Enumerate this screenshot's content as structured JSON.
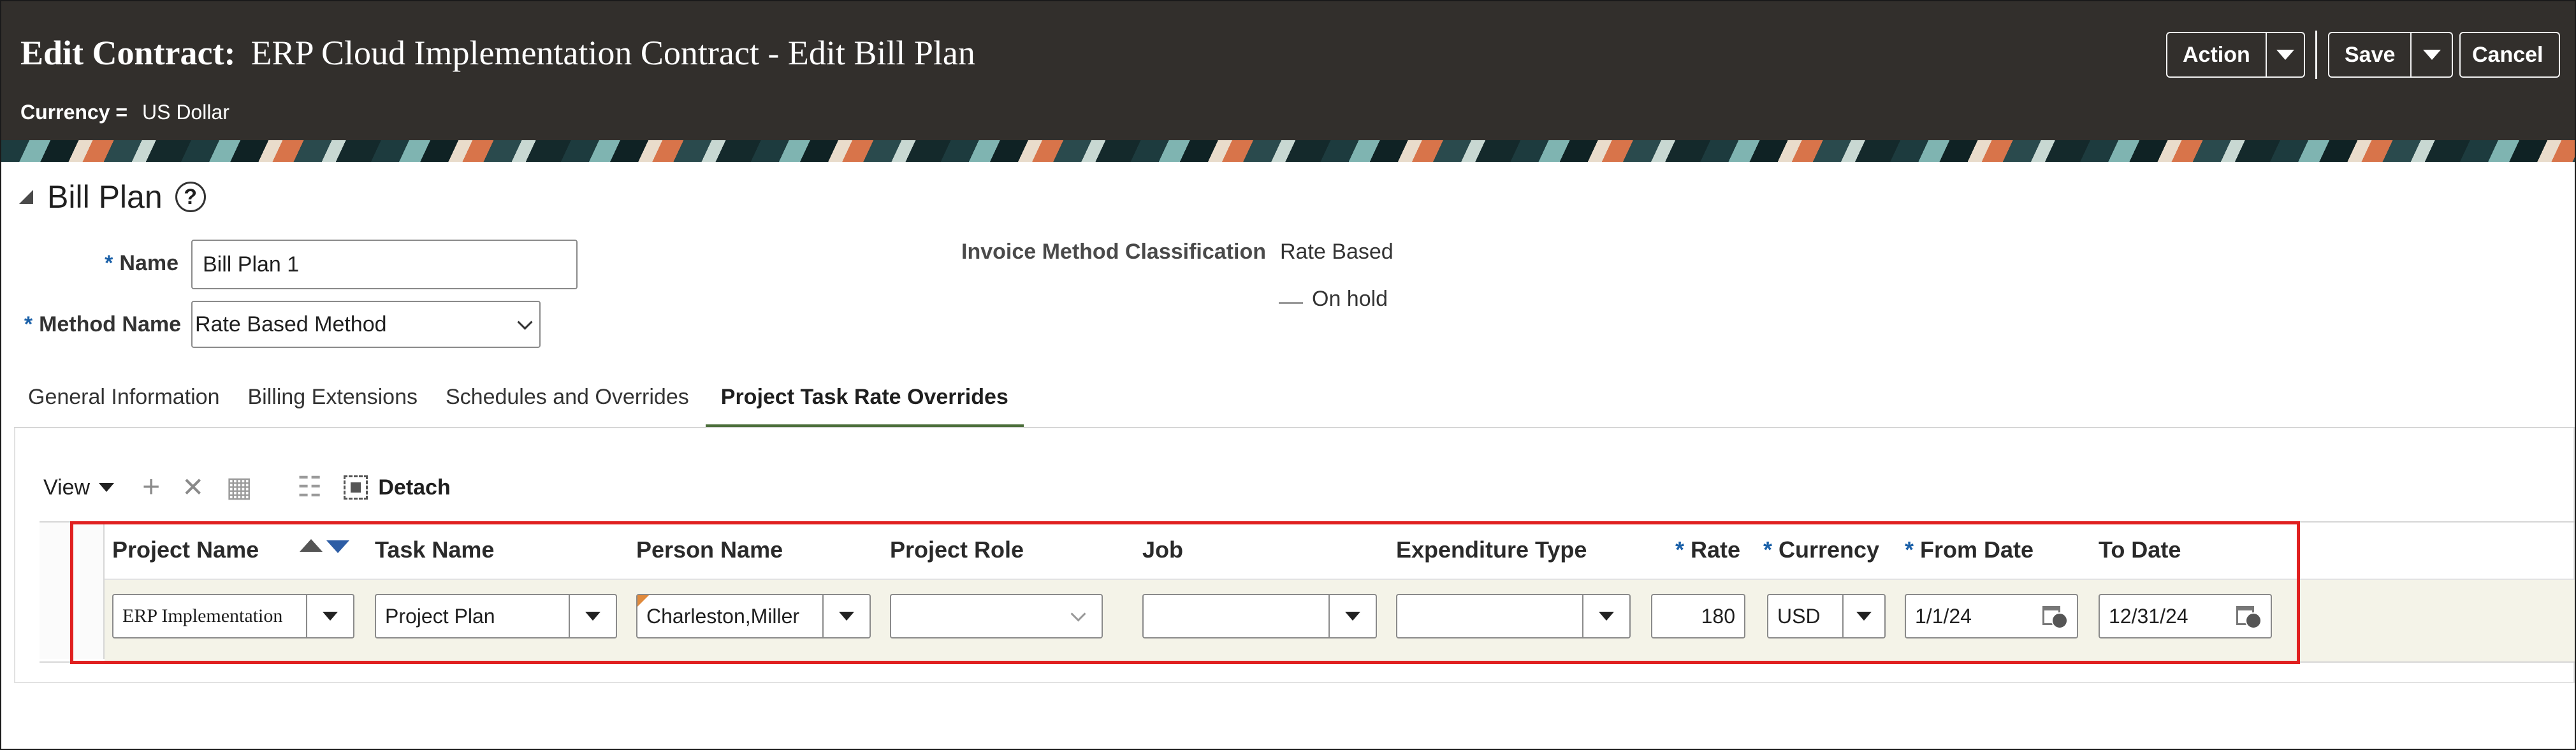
{
  "header": {
    "title_label": "Edit Contract:",
    "title_text": "ERP Cloud Implementation Contract - Edit Bill Plan",
    "currency_label": "Currency =",
    "currency_value": "US Dollar",
    "buttons": {
      "action": "Action",
      "save": "Save",
      "cancel": "Cancel"
    }
  },
  "section": {
    "title": "Bill Plan",
    "help": "?",
    "name_label": "Name",
    "name_value": "Bill Plan 1",
    "method_label": "Method Name",
    "method_value": "Rate Based Method",
    "invoice_method_label": "Invoice Method Classification",
    "invoice_method_value": "Rate Based",
    "on_hold_label": "On hold",
    "required_mark": "*"
  },
  "tabs": [
    {
      "label": "General Information",
      "active": false
    },
    {
      "label": "Billing Extensions",
      "active": false
    },
    {
      "label": "Schedules and Overrides",
      "active": false
    },
    {
      "label": "Project Task Rate Overrides",
      "active": true
    }
  ],
  "toolbar": {
    "view_label": "View",
    "add_icon": "+",
    "delete_icon": "✕",
    "grid_icon": "▦",
    "filter_icon": "☷",
    "detach_label": "Detach"
  },
  "table": {
    "columns": {
      "project_name": "Project Name",
      "task_name": "Task Name",
      "person_name": "Person Name",
      "project_role": "Project Role",
      "job": "Job",
      "expenditure_type": "Expenditure Type",
      "rate": "Rate",
      "currency": "Currency",
      "from_date": "From Date",
      "to_date": "To Date"
    },
    "row": {
      "project_name": "ERP Implementation",
      "task_name": "Project Plan",
      "person_name": "Charleston,Miller",
      "project_role": "",
      "job": "",
      "expenditure_type": "",
      "rate": "180",
      "currency": "USD",
      "from_date": "1/1/24",
      "to_date": "12/31/24"
    }
  },
  "colors": {
    "header_bg": "#322f2c",
    "required": "#1a60a8",
    "active_tab": "#4b6e3a",
    "row_highlight": "#f4f3e8",
    "annotation_box": "#e02020"
  }
}
